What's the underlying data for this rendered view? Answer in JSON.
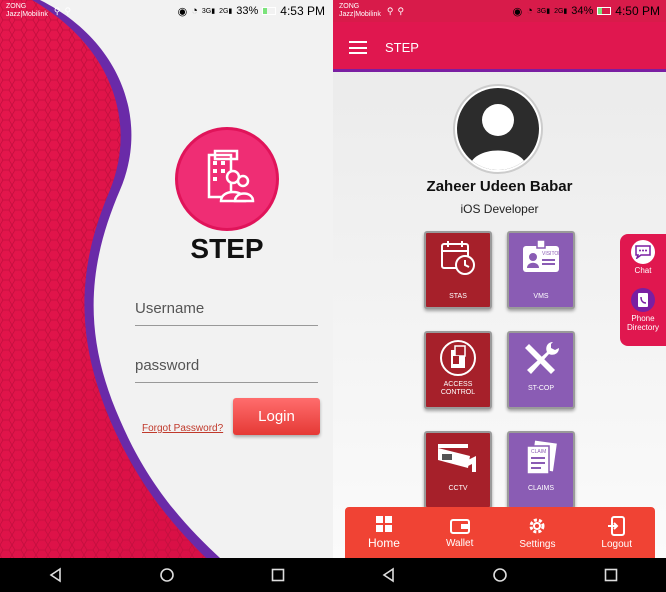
{
  "left_screen": {
    "status": {
      "carrier_line1": "ZONG",
      "carrier_line2": "Jazz|Mobilink",
      "battery": "33%",
      "time": "4:53 PM",
      "network1": "3G",
      "network2": "2G"
    },
    "app_title": "STEP",
    "username_placeholder": "Username",
    "password_placeholder": "password",
    "forgot_password": "Forgot Password?",
    "login_label": "Login"
  },
  "right_screen": {
    "status": {
      "carrier_line1": "ZONG",
      "carrier_line2": "Jazz|Mobilink",
      "battery": "34%",
      "time": "4:50 PM",
      "network1": "3G",
      "network2": "2G"
    },
    "toolbar_title": "STEP",
    "user_name": "Zaheer Udeen Babar",
    "user_role": "iOS Developer",
    "tiles": [
      {
        "label": "STAS",
        "icon": "calendar-clock-icon"
      },
      {
        "label": "VMS",
        "icon": "visitor-badge-icon"
      },
      {
        "label": "ACCESS CONTROL",
        "icon": "door-access-icon"
      },
      {
        "label": "ST-COP",
        "icon": "tools-icon"
      },
      {
        "label": "CCTV",
        "icon": "cctv-camera-icon"
      },
      {
        "label": "CLAIMS",
        "icon": "claim-documents-icon"
      }
    ],
    "side_panel": [
      {
        "label": "Chat",
        "icon": "chat-icon"
      },
      {
        "label": "Phone Directory",
        "icon": "phone-directory-icon"
      }
    ],
    "bottom_nav": [
      {
        "label": "Home",
        "icon": "home-grid-icon"
      },
      {
        "label": "Wallet",
        "icon": "wallet-icon"
      },
      {
        "label": "Settings",
        "icon": "settings-gear-icon"
      },
      {
        "label": "Logout",
        "icon": "logout-icon"
      }
    ]
  },
  "colors": {
    "primary": "#e0174f",
    "accent_purple": "#7a1fa2",
    "tile_red": "#a6202a",
    "tile_purple": "#8a5cb4",
    "bottom_nav": "#f04334"
  }
}
